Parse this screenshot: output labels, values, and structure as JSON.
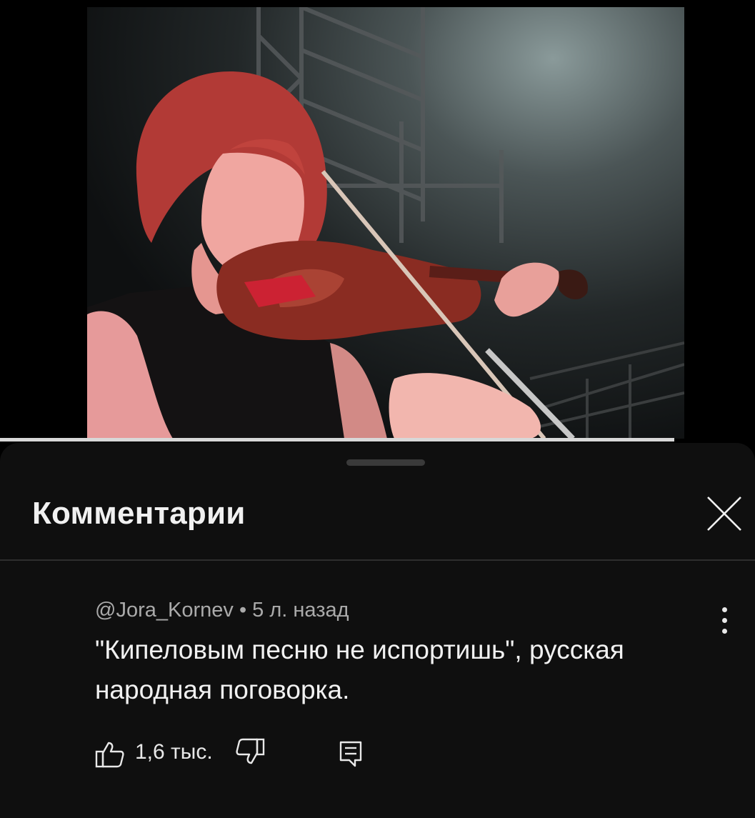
{
  "video": {
    "progress_fraction": 0.893
  },
  "comments_panel": {
    "title": "Комментарии",
    "close_icon": "close-icon"
  },
  "comment": {
    "author": "@Jora_Kornev",
    "separator": "•",
    "time": "5 л. назад",
    "text": "\"Кипеловым песню не испортишь\", русская народная поговорка.",
    "like_count": "1,6 тыс.",
    "icons": {
      "like": "thumbs-up-icon",
      "dislike": "thumbs-down-icon",
      "reply": "reply-icon",
      "more": "more-vert-icon"
    }
  }
}
